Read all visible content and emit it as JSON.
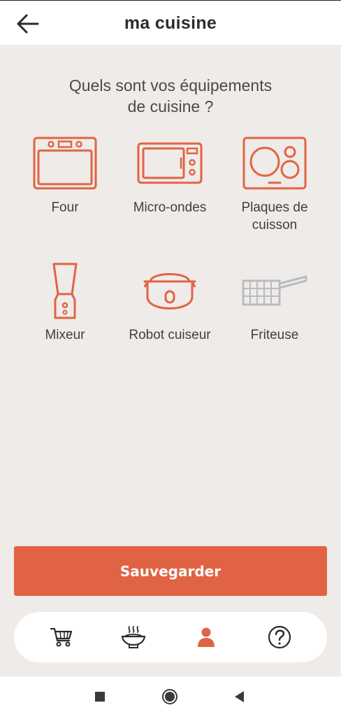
{
  "header": {
    "back_icon": "arrow-left-icon",
    "title": "ma cuisine"
  },
  "question": {
    "line1": "Quels sont vos équipements",
    "line2": "de cuisine ?"
  },
  "equipment": [
    {
      "label_line1": "Four",
      "label_line2": "",
      "icon": "oven-icon",
      "selected": true
    },
    {
      "label_line1": "Micro-ondes",
      "label_line2": "",
      "icon": "microwave-icon",
      "selected": true
    },
    {
      "label_line1": "Plaques de",
      "label_line2": "cuisson",
      "icon": "cooktop-icon",
      "selected": true
    },
    {
      "label_line1": "Mixeur",
      "label_line2": "",
      "icon": "blender-icon",
      "selected": true
    },
    {
      "label_line1": "Robot cuiseur",
      "label_line2": "",
      "icon": "rice-cooker-icon",
      "selected": true
    },
    {
      "label_line1": "Friteuse",
      "label_line2": "",
      "icon": "fryer-basket-icon",
      "selected": false
    }
  ],
  "save_button": {
    "label": "Sauvegarder"
  },
  "bottom_nav": [
    {
      "icon": "cart-icon",
      "active": false
    },
    {
      "icon": "meal-bowl-icon",
      "active": false
    },
    {
      "icon": "profile-icon",
      "active": true
    },
    {
      "icon": "help-icon",
      "active": false
    }
  ],
  "system_nav": [
    "recents-square-icon",
    "home-circle-icon",
    "back-triangle-icon"
  ],
  "colors": {
    "accent": "#e06444",
    "inactive_icon": "#b9bcc0",
    "background": "#efebe8",
    "text": "#3f3f3f"
  }
}
